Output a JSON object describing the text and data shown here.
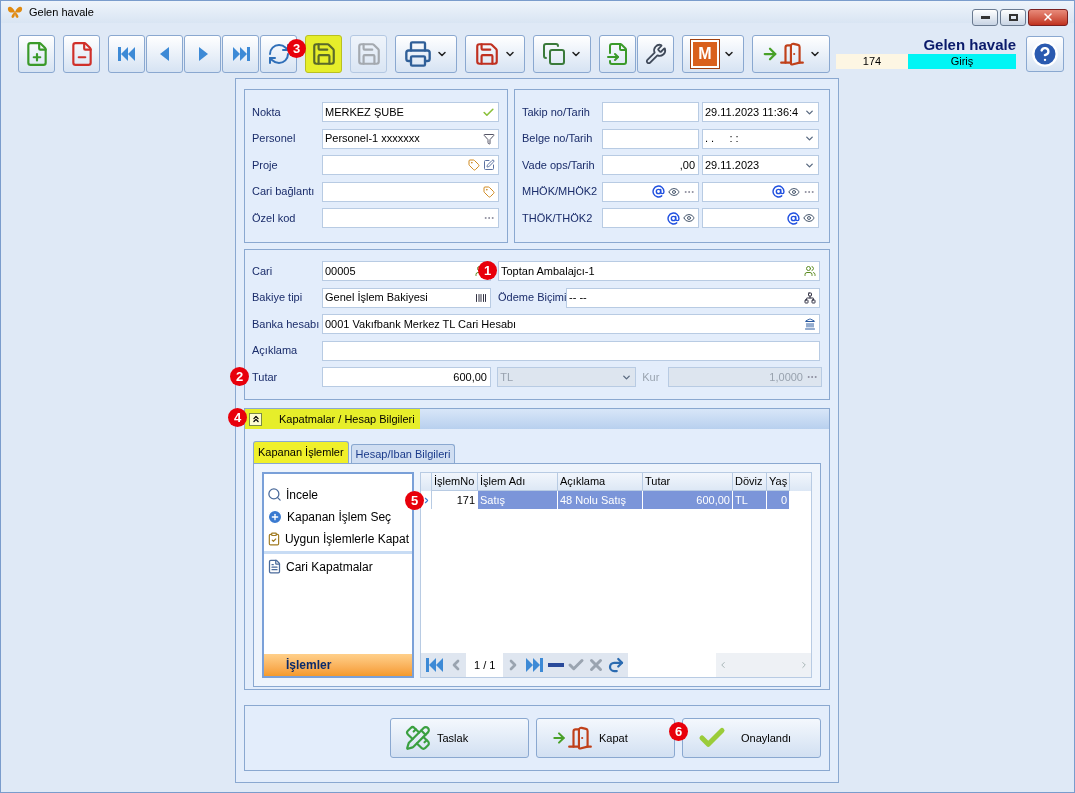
{
  "window": {
    "title": "Gelen havale"
  },
  "toolbar": {
    "groups": [
      [
        {
          "dropdown": false,
          "highlighted": false,
          "disabled": false
        }
      ],
      [
        {
          "dropdown": false,
          "highlighted": false,
          "disabled": false
        }
      ],
      [
        {
          "dropdown": false,
          "highlighted": false,
          "disabled": false
        },
        {
          "dropdown": false,
          "highlighted": false,
          "disabled": false
        },
        {
          "dropdown": false,
          "highlighted": false,
          "disabled": false
        },
        {
          "dropdown": false,
          "highlighted": false,
          "disabled": false
        },
        {
          "dropdown": false,
          "highlighted": false,
          "disabled": false
        }
      ],
      [
        {
          "dropdown": false,
          "highlighted": true,
          "disabled": false,
          "badge": "3"
        }
      ],
      [
        {
          "dropdown": false,
          "highlighted": false,
          "disabled": true
        }
      ],
      [
        {
          "dropdown": true,
          "highlighted": false,
          "disabled": false
        }
      ],
      [
        {
          "dropdown": true,
          "highlighted": false,
          "disabled": false
        }
      ],
      [
        {
          "dropdown": true,
          "highlighted": false,
          "disabled": false
        }
      ],
      [
        {
          "dropdown": false,
          "highlighted": false,
          "disabled": false
        },
        {
          "dropdown": false,
          "highlighted": false,
          "disabled": false
        }
      ],
      [
        {
          "dropdown": true,
          "highlighted": false,
          "disabled": false,
          "label": "M"
        }
      ],
      [
        {
          "dropdown": true,
          "highlighted": false,
          "disabled": false
        }
      ]
    ]
  },
  "header": {
    "title": "Gelen havale",
    "number": "174",
    "mode": "Giriş"
  },
  "general_left": [
    {
      "label": "Nokta",
      "value": "MERKEZ ŞUBE"
    },
    {
      "label": "Personel",
      "value": "Personel-1 xxxxxxx"
    },
    {
      "label": "Proje"
    },
    {
      "label": "Cari bağlantı"
    },
    {
      "label": "Özel kod"
    }
  ],
  "general_right": [
    {
      "label": "Takip no/Tarih",
      "date": "29.11.2023 11:36:4"
    },
    {
      "label": "Belge no/Tarih",
      "date": ". .     : :"
    },
    {
      "label": "Vade ops/Tarih",
      "value": ",00",
      "date": "29.11.2023"
    },
    {
      "label": "MHÖK/MHÖK2"
    },
    {
      "label": "THÖK/THÖK2"
    }
  ],
  "account": {
    "cari_label": "Cari",
    "cari_code": "00005",
    "cari_name": "Toptan Ambalajcı-1",
    "cari_badge": "1",
    "bakiye_label": "Bakiye tipi",
    "bakiye_value": "Genel İşlem Bakiyesi",
    "odeme_label": "Ödeme Biçimi",
    "odeme_value": "-- --",
    "banka_label": "Banka hesabı",
    "banka_value": "0001 Vakıfbank Merkez TL Cari Hesabı",
    "aciklama_label": "Açıklama",
    "tutar_label": "Tutar",
    "tutar_value": "600,00",
    "tutar_badge": "2",
    "currency": "TL",
    "currency_disabled": true,
    "kur_label": "Kur",
    "kur_value": "1,0000",
    "kur_disabled": true
  },
  "closings": {
    "title": "Kapatmalar / Hesap Bilgileri",
    "expanded": true,
    "highlighted": true,
    "badge": "4",
    "tabs": [
      {
        "label": "Kapanan İşlemler",
        "selected": true,
        "highlighted": true
      },
      {
        "label": "Hesap/Iban Bilgileri",
        "selected": false,
        "highlighted": false
      }
    ],
    "action_groups": [
      [
        {
          "label": "İncele"
        },
        {
          "label": "Kapanan İşlem Seç"
        },
        {
          "label": "Uygun İşlemlerle Kapat"
        }
      ],
      [
        {
          "label": "Cari Kapatmalar"
        }
      ]
    ],
    "actions_footer": "İşlemler",
    "columns": [
      "İşlemNo",
      "İşlem Adı",
      "Açıklama",
      "Tutar",
      "Döviz",
      "Yaş"
    ],
    "rows": [
      {
        "cells": [
          "171",
          "Satış",
          "48 Nolu Satış",
          "600,00",
          "TL",
          "0"
        ],
        "selected": true,
        "badge": "5"
      }
    ],
    "pager": "1 / 1"
  },
  "buttons": [
    {
      "label": "Taslak"
    },
    {
      "label": "Kapat",
      "badge": "6"
    },
    {
      "label": "Onaylandı"
    }
  ]
}
